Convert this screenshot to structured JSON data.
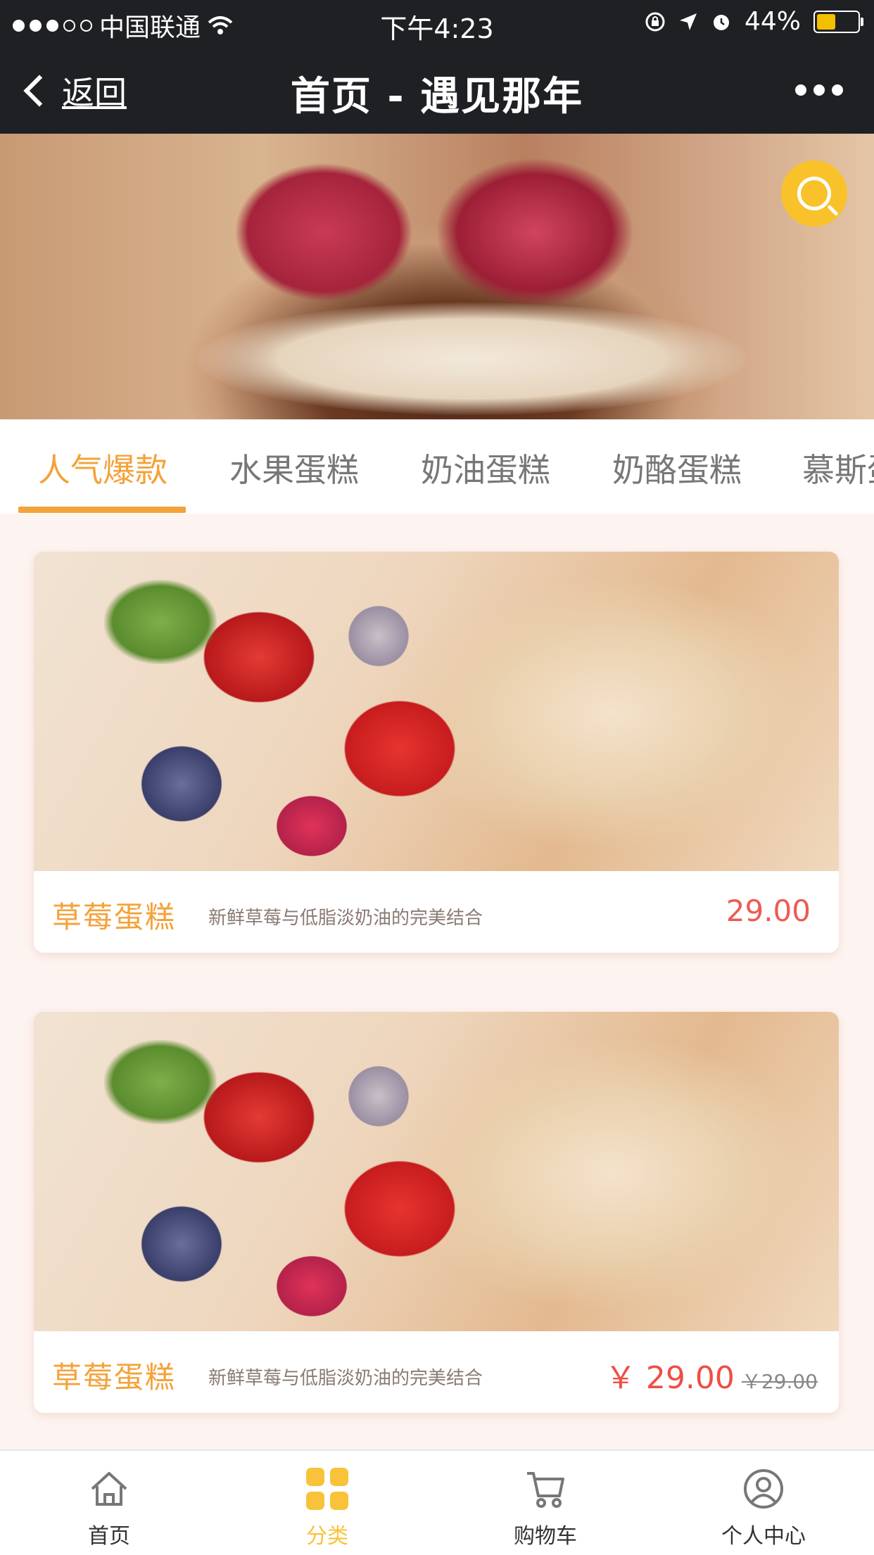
{
  "status_bar": {
    "carrier": "中国联通",
    "time": "下午4:23",
    "battery": "44%"
  },
  "nav": {
    "back_label": "返回",
    "title": "首页 - 遇见那年"
  },
  "tabs": [
    {
      "label": "人气爆款"
    },
    {
      "label": "水果蛋糕"
    },
    {
      "label": "奶油蛋糕"
    },
    {
      "label": "奶酪蛋糕"
    },
    {
      "label": "慕斯蛋"
    }
  ],
  "products": [
    {
      "name": "草莓蛋糕",
      "desc": "新鲜草莓与低脂淡奶油的完美结合",
      "price": "29.00"
    },
    {
      "name": "草莓蛋糕",
      "desc": "新鲜草莓与低脂淡奶油的完美结合",
      "price": "￥ 29.00",
      "old_price": "￥29.00"
    }
  ],
  "tabbar": [
    {
      "label": "首页"
    },
    {
      "label": "分类"
    },
    {
      "label": "购物车"
    },
    {
      "label": "个人中心"
    }
  ],
  "colors": {
    "accent": "#f4a23a",
    "price": "#ee5a52",
    "active_tab_icon": "#f8c33a",
    "nav_bg": "#1f2023"
  }
}
